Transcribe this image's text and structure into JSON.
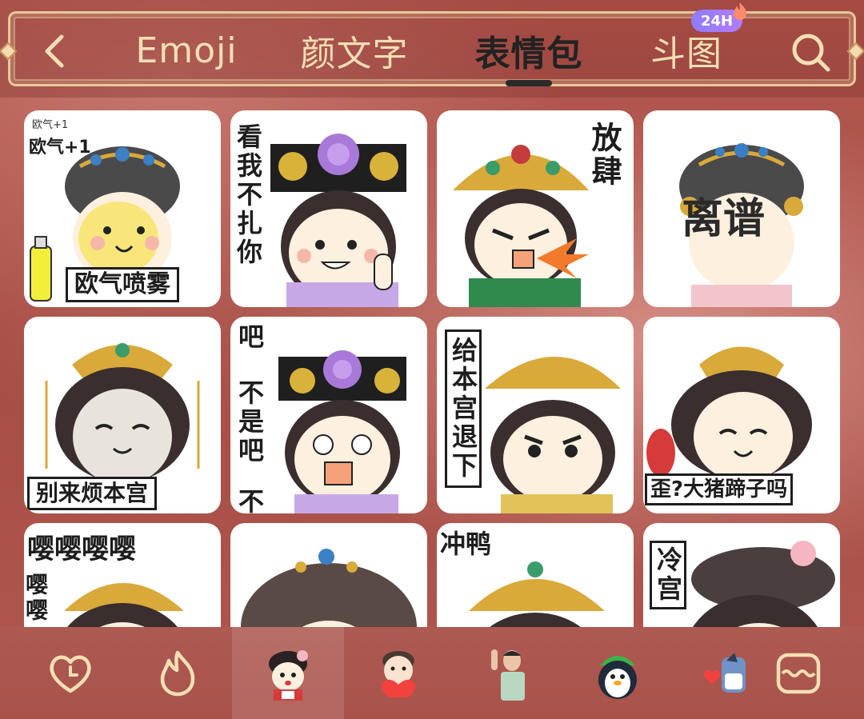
{
  "tabs": [
    {
      "label": "Emoji",
      "active": false
    },
    {
      "label": "颜文字",
      "active": false
    },
    {
      "label": "表情包",
      "active": true
    },
    {
      "label": "斗图",
      "active": false,
      "badge": "24H"
    }
  ],
  "icons": {
    "back": "chevron-left-icon",
    "search": "search-icon",
    "badge": "flame-icon"
  },
  "colors": {
    "tab_text": "#f6dfb4",
    "tab_active": "#222222",
    "frame": "#e8c89a",
    "background": "#a8524a",
    "badge": "#9a7cff"
  },
  "stickers": [
    {
      "caption": "欧气喷雾",
      "note": "欧气+1",
      "note2": "欧气+1"
    },
    {
      "caption": "看我不扎你"
    },
    {
      "caption": "放肆"
    },
    {
      "caption": "离谱"
    },
    {
      "caption": "别来烦本宫"
    },
    {
      "caption": "吧",
      "caption2": "不是吧",
      "caption3": "不"
    },
    {
      "caption": "给本宫退下"
    },
    {
      "caption": "歪?大猪蹄子吗"
    },
    {
      "caption": "嘤嘤嘤嘤",
      "caption_side": "嘤嘤"
    },
    {
      "caption": ""
    },
    {
      "caption": "冲鸭"
    },
    {
      "caption": "冷宫"
    }
  ],
  "bottom_categories": [
    {
      "name": "recent",
      "icon": "heart-clock-icon",
      "active": false
    },
    {
      "name": "hot",
      "icon": "flame-icon",
      "active": false
    },
    {
      "name": "palace-girl",
      "icon": "palace-girl-avatar",
      "active": true
    },
    {
      "name": "boy-heart",
      "icon": "boy-heart-avatar",
      "active": false
    },
    {
      "name": "waving-man",
      "icon": "waving-man-avatar",
      "active": false
    },
    {
      "name": "penguin",
      "icon": "penguin-avatar",
      "active": false
    },
    {
      "name": "shark",
      "icon": "shark-avatar",
      "active": false
    },
    {
      "name": "collection",
      "icon": "sticker-box-icon",
      "active": false
    }
  ]
}
